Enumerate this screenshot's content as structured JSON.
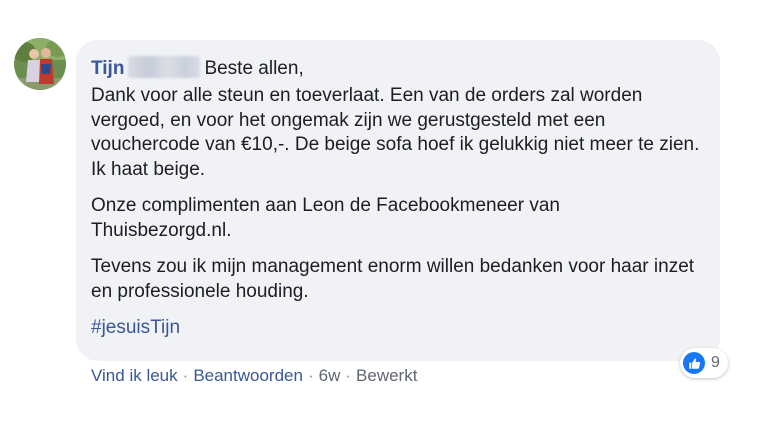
{
  "comment": {
    "author": "Tijn",
    "first_line": "Beste allen,",
    "paragraphs": [
      "Dank voor alle steun en toeverlaat. Een van de orders zal worden vergoed, en voor het ongemak zijn we gerustgesteld met een vouchercode van €10,-. De beige sofa hoef ik gelukkig niet meer te zien. Ik haat beige.",
      "Onze complimenten aan Leon de Facebookmeneer van Thuisbezorgd.nl.",
      "Tevens zou ik mijn management enorm willen bedanken voor haar inzet en professionele houding."
    ],
    "hashtag": "#jesuisTijn"
  },
  "reactions": {
    "icon": "thumbs-up-icon",
    "count": "9"
  },
  "actions": {
    "like": "Vind ik leuk",
    "reply": "Beantwoorden",
    "separator": "·",
    "timestamp": "6w",
    "edited": "Bewerkt"
  },
  "colors": {
    "bubble_bg": "#f0f2f5",
    "link_blue": "#385898",
    "like_blue": "#1877f2",
    "meta_grey": "#606770"
  }
}
